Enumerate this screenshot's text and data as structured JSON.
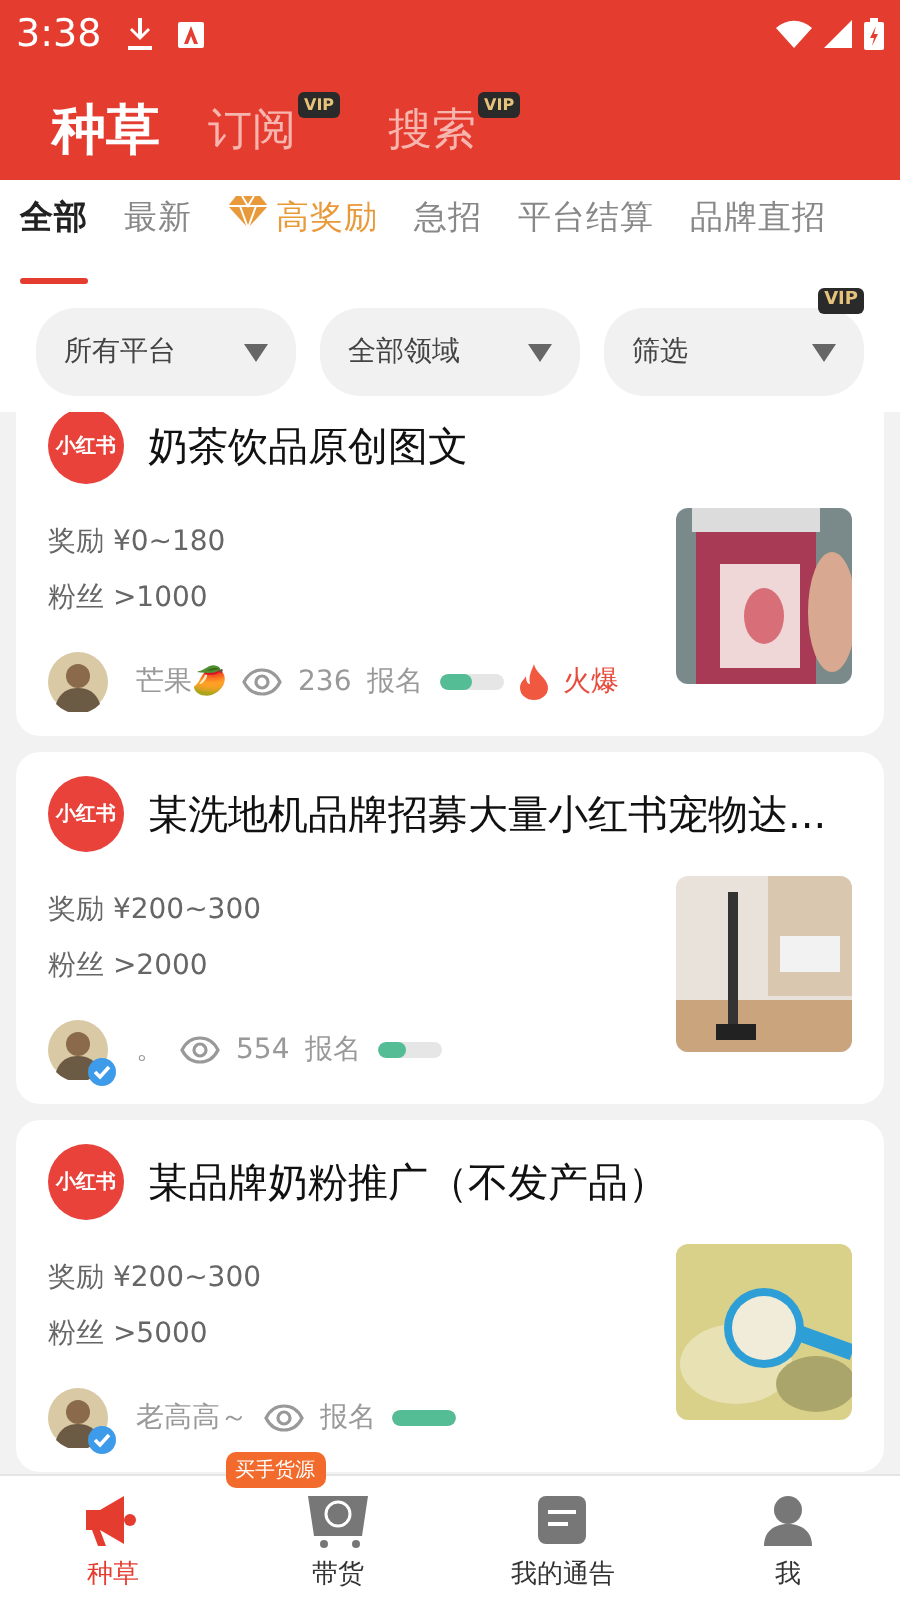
{
  "status_bar": {
    "time": "3:38"
  },
  "header_tabs": [
    {
      "label": "种草",
      "selected": true
    },
    {
      "label": "订阅",
      "selected": false,
      "badge": "VIP"
    },
    {
      "label": "搜索",
      "selected": false,
      "badge": "VIP"
    }
  ],
  "categories": [
    {
      "label": "全部",
      "selected": true,
      "kind": "plain"
    },
    {
      "label": "最新",
      "selected": false,
      "kind": "plain"
    },
    {
      "label": "高奖励",
      "selected": false,
      "kind": "premium"
    },
    {
      "label": "急招",
      "selected": false,
      "kind": "plain"
    },
    {
      "label": "平台结算",
      "selected": false,
      "kind": "plain"
    },
    {
      "label": "品牌直招",
      "selected": false,
      "kind": "plain"
    }
  ],
  "filters": [
    {
      "label": "所有平台"
    },
    {
      "label": "全部领域"
    },
    {
      "label": "筛选",
      "badge": "VIP"
    }
  ],
  "cards": [
    {
      "platform": "小红书",
      "title": "奶茶饮品原创图文",
      "reward": "奖励 ¥0~180",
      "fans": "粉丝 >1000",
      "author": "芒果🥭",
      "verified": false,
      "views": "236",
      "signup_label": "报名",
      "level": 0.5,
      "hot": "火爆"
    },
    {
      "platform": "小红书",
      "title": "某洗地机品牌招募大量小红书宠物达...",
      "reward": "奖励 ¥200~300",
      "fans": "粉丝 >2000",
      "author": "。",
      "verified": true,
      "views": "554",
      "signup_label": "报名",
      "level": 0.45
    },
    {
      "platform": "小红书",
      "title": "某品牌奶粉推广（不发产品）",
      "reward": "奖励 ¥200~300",
      "fans": "粉丝 >5000",
      "author": "老高高～",
      "verified": true,
      "signup_label": "报名",
      "level": 1
    }
  ],
  "bottom_nav": [
    {
      "label": "种草",
      "selected": true,
      "kind": "megaphone"
    },
    {
      "label": "带货",
      "selected": false,
      "kind": "cart",
      "badge": "买手货源"
    },
    {
      "label": "我的通告",
      "selected": false,
      "kind": "doc"
    },
    {
      "label": "我",
      "selected": false,
      "kind": "person"
    }
  ]
}
